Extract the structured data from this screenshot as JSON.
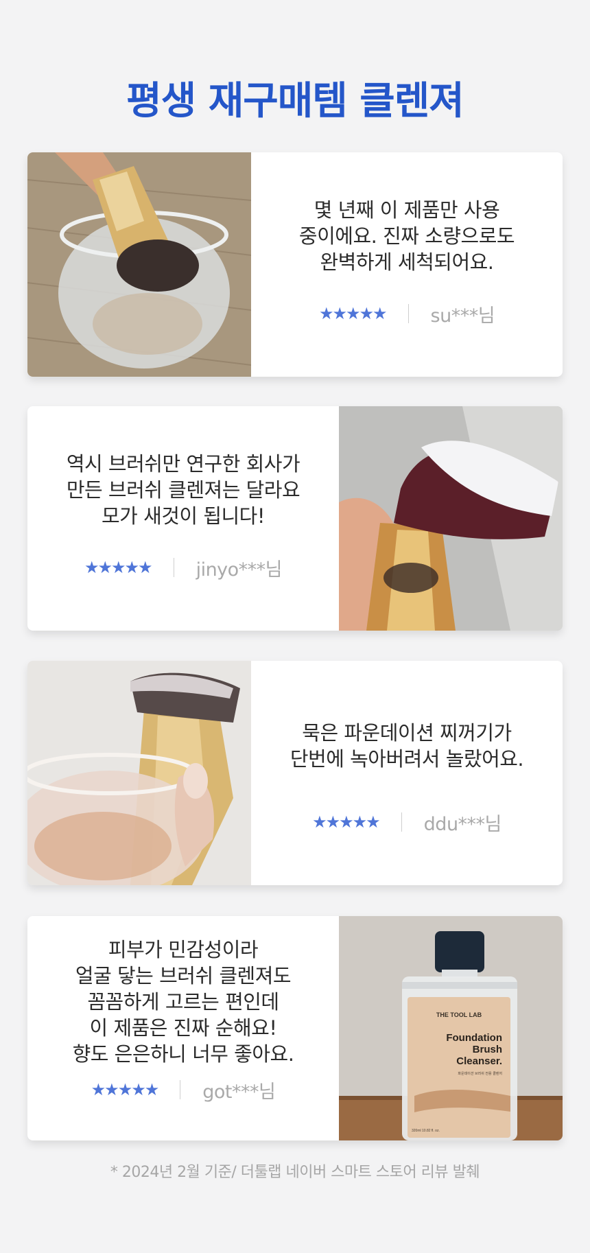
{
  "header": {
    "title": "평생 재구매템 클렌져",
    "title_color": "#2456c9"
  },
  "reviews": [
    {
      "lines": [
        "몇 년째 이 제품만 사용",
        "중이에요. 진짜 소량으로도",
        "완벽하게 세척되어요."
      ],
      "stars": "★★★★★",
      "author": "su***님",
      "photo": "brush-in-cup-photo"
    },
    {
      "lines": [
        "역시 브러쉬만 연구한 회사가",
        "만든 브러쉬 클렌져는 달라요",
        "모가 새것이 됩니다!"
      ],
      "stars": "★★★★★",
      "author": "jinyo***님",
      "photo": "clean-brush-photo"
    },
    {
      "lines": [
        "묵은 파운데이션 찌꺼기가",
        "단번에 녹아버려서 놀랐어요."
      ],
      "stars": "★★★★★",
      "author": "ddu***님",
      "photo": "brush-and-cup-photo"
    },
    {
      "lines": [
        "피부가 민감성이라",
        "얼굴 닿는 브러쉬 클렌져도",
        "꼼꼼하게 고르는 편인데",
        "이 제품은 진짜 순해요!",
        "향도 은은하니 너무 좋아요."
      ],
      "stars": "★★★★★",
      "author": "got***님",
      "photo": "product-bottle-photo"
    }
  ],
  "bottle": {
    "brand": "THE TOOL LAB",
    "name_line1": "Foundation",
    "name_line2": "Brush",
    "name_line3": "Cleanser.",
    "subtitle": "파운데이션 브러쉬 전용 클렌저",
    "volume": "320ml   10.82 fl. oz."
  },
  "footnote": "* 2024년 2월 기준/ 더툴랩 네이버 스마트 스토어 리뷰 발췌",
  "colors": {
    "star": "#4f75d8",
    "author": "#a9a9a9",
    "background": "#f3f3f4"
  }
}
